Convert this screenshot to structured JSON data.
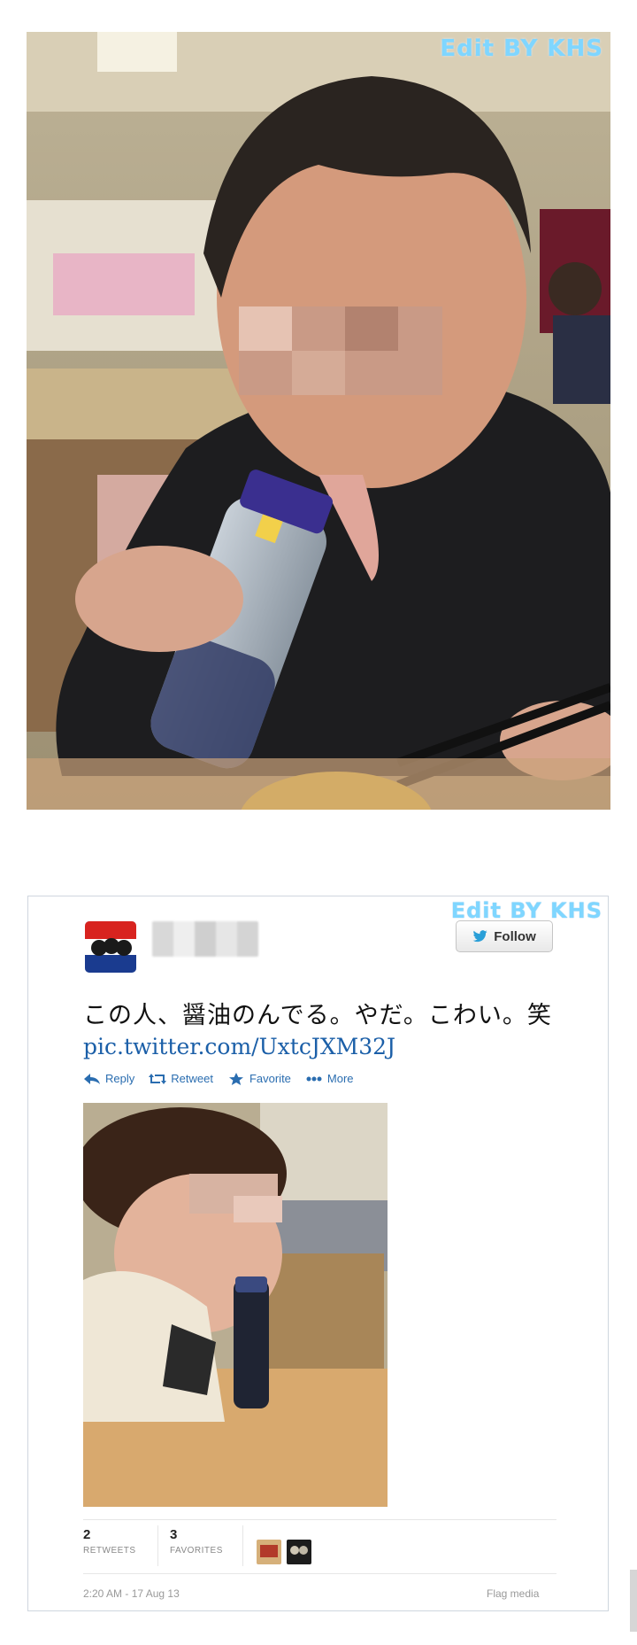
{
  "photo1": {
    "watermark": "Edit BY KHS"
  },
  "tweet": {
    "watermark": "Edit BY KHS",
    "follow_label": "Follow",
    "text": "この人、醤油のんでる。やだ。こわい。笑",
    "link": "pic.twitter.com/UxtcJXM32J",
    "actions": [
      {
        "label": "Reply",
        "icon": "reply-icon"
      },
      {
        "label": "Retweet",
        "icon": "retweet-icon"
      },
      {
        "label": "Favorite",
        "icon": "star-icon"
      },
      {
        "label": "More",
        "icon": "more-icon"
      }
    ],
    "stats": {
      "retweets_count": "2",
      "retweets_label": "RETWEETS",
      "favorites_count": "3",
      "favorites_label": "FAVORITES"
    },
    "timestamp": "2:20 AM - 17 Aug 13",
    "flag_label": "Flag media"
  },
  "colors": {
    "link_blue": "#1b5fa8",
    "twitter_blue": "#2a9fd8",
    "watermark": "#7fd6ff"
  }
}
